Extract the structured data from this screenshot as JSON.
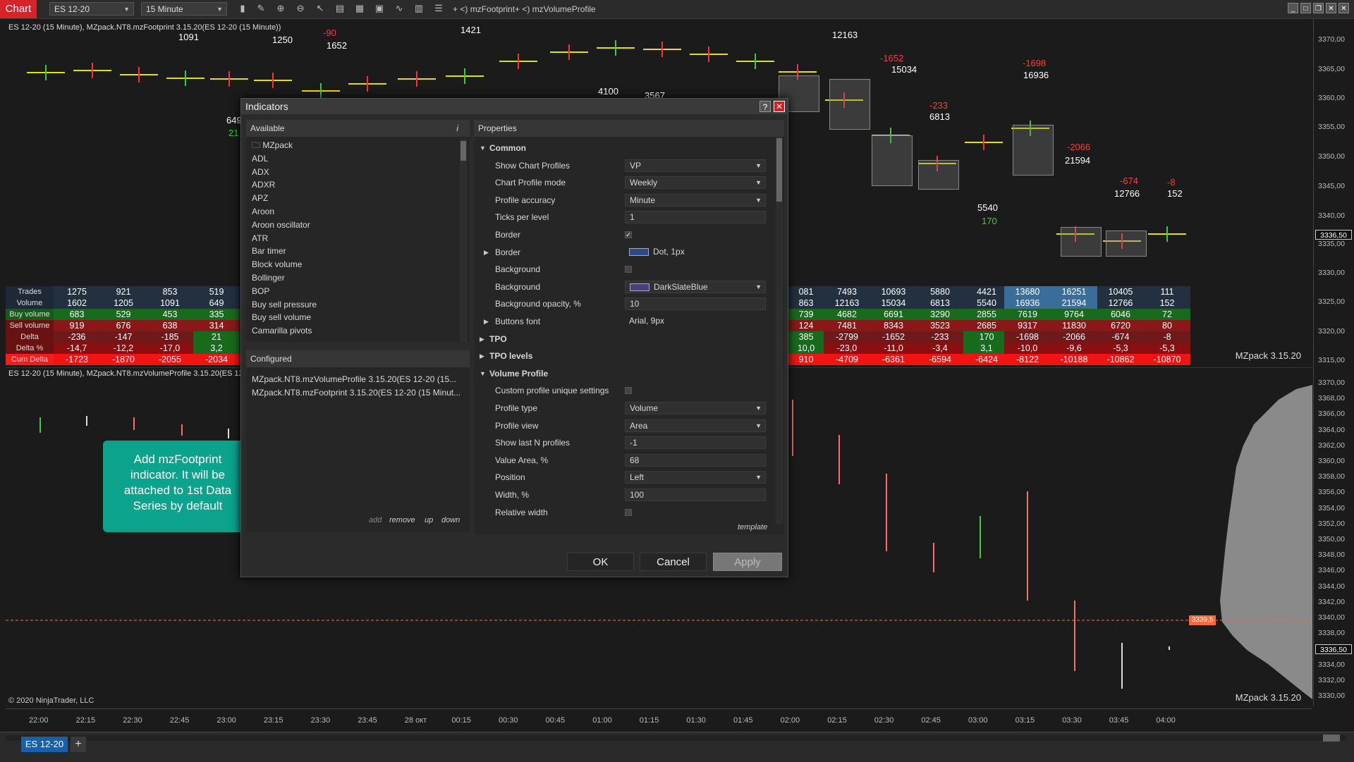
{
  "toolbar": {
    "chart_tab": "Chart",
    "instrument": "ES 12-20",
    "interval": "15 Minute",
    "indicator1": "mzFootprint",
    "indicator2": "mzVolumeProfile",
    "icons": [
      "bar-style-icon",
      "draw-icon",
      "zoom-in-icon",
      "zoom-out-icon",
      "pointer-icon",
      "data-box-icon",
      "properties-icon",
      "strategies-icon",
      "indicators-icon",
      "chart-trader-icon",
      "list-icon"
    ]
  },
  "panel_top": {
    "label": "ES 12-20 (15 Minute), MZpack.NT8.mzFootprint 3.15.20(ES 12-20 (15 Minute))",
    "watermark": "MZpack 3.15.20"
  },
  "panel_bottom": {
    "label": "ES 12-20 (15 Minute), MZpack.NT8.mzVolumeProfile 3.15.20(ES 12-20 (15 Minute))",
    "watermark": "MZpack 3.15.20",
    "copyright": "© 2020 NinjaTrader, LLC"
  },
  "prices_top": [
    "3370,00",
    "3365,00",
    "3360,00",
    "3355,00",
    "3350,00",
    "3345,00",
    "3340,00",
    "3336,50",
    "3335,00",
    "3330,00",
    "3325,00",
    "3320,00",
    "3315,00"
  ],
  "prices_bottom": [
    "3370,00",
    "3368,00",
    "3366,00",
    "3364,00",
    "3362,00",
    "3360,00",
    "3358,00",
    "3356,00",
    "3354,00",
    "3352,00",
    "3350,00",
    "3348,00",
    "3346,00",
    "3344,00",
    "3342,00",
    "3340,00",
    "3338,00",
    "3336,50",
    "3334,00",
    "3332,00",
    "3330,00"
  ],
  "price_marker_top": "3336,50",
  "price_marker_bottom": "3336,50",
  "hline_label": "3339,5",
  "times": [
    "22:00",
    "22:15",
    "22:30",
    "22:45",
    "23:00",
    "23:15",
    "23:30",
    "23:45",
    "28 окт",
    "00:15",
    "00:30",
    "00:45",
    "01:00",
    "01:15",
    "01:30",
    "01:45",
    "02:00",
    "02:15",
    "02:30",
    "02:45",
    "03:00",
    "03:15",
    "03:30",
    "03:45",
    "04:00"
  ],
  "stats": {
    "labels": [
      "Trades",
      "Volume",
      "Buy volume",
      "Sell volume",
      "Delta",
      "Delta %",
      "Cum Delta"
    ],
    "left_cols": [
      [
        "1275",
        "1602",
        "683",
        "919",
        "-236",
        "-14,7",
        "-1723"
      ],
      [
        "921",
        "1205",
        "529",
        "676",
        "-147",
        "-12,2",
        "-1870"
      ],
      [
        "853",
        "1091",
        "453",
        "638",
        "-185",
        "-17,0",
        "-2055"
      ],
      [
        "519",
        "649",
        "335",
        "314",
        "21",
        "3,2",
        "-2034"
      ]
    ],
    "right_cols": [
      [
        "081",
        "863",
        "739",
        "124",
        "385",
        "10,0",
        "910"
      ],
      [
        "7493",
        "12163",
        "4682",
        "7481",
        "-2799",
        "-23,0",
        "-4709"
      ],
      [
        "10693",
        "15034",
        "6691",
        "8343",
        "-1652",
        "-11,0",
        "-6361"
      ],
      [
        "5880",
        "6813",
        "3290",
        "3523",
        "-233",
        "-3,4",
        "-6594"
      ],
      [
        "4421",
        "5540",
        "2855",
        "2685",
        "170",
        "3,1",
        "-6424"
      ],
      [
        "13680",
        "16936",
        "7619",
        "9317",
        "-1698",
        "-10,0",
        "-8122"
      ],
      [
        "16251",
        "21594",
        "9764",
        "11830",
        "-2066",
        "-9,6",
        "-10188"
      ],
      [
        "10405",
        "12766",
        "6046",
        "6720",
        "-674",
        "-5,3",
        "-10862"
      ],
      [
        "111",
        "152",
        "72",
        "80",
        "-8",
        "-5,3",
        "-10870"
      ]
    ]
  },
  "footprint_labels": [
    {
      "t": "1091",
      "c": "#fff"
    },
    {
      "t": "1250",
      "c": "#fff"
    },
    {
      "t": "-90",
      "c": "#ff3b3b"
    },
    {
      "t": "1652",
      "c": "#fff"
    },
    {
      "t": "1421",
      "c": "#fff"
    },
    {
      "t": "4100",
      "c": "#fff"
    },
    {
      "t": "3567",
      "c": "#fff"
    },
    {
      "t": "12163",
      "c": "#fff"
    },
    {
      "t": "-1652",
      "c": "#ff3b3b"
    },
    {
      "t": "15034",
      "c": "#fff"
    },
    {
      "t": "-233",
      "c": "#ff3b3b"
    },
    {
      "t": "6813",
      "c": "#fff"
    },
    {
      "t": "-1698",
      "c": "#ff3b3b"
    },
    {
      "t": "16936",
      "c": "#fff"
    },
    {
      "t": "-2066",
      "c": "#ff3b3b"
    },
    {
      "t": "21594",
      "c": "#fff"
    },
    {
      "t": "-674",
      "c": "#ff3b3b"
    },
    {
      "t": "12766",
      "c": "#fff"
    },
    {
      "t": "-8",
      "c": "#ff3b3b"
    },
    {
      "t": "152",
      "c": "#fff"
    },
    {
      "t": "5540",
      "c": "#fff"
    },
    {
      "t": "170",
      "c": "#36d136"
    },
    {
      "t": "649",
      "c": "#fff"
    },
    {
      "t": "21",
      "c": "#36d136"
    }
  ],
  "dialog": {
    "title": "Indicators",
    "available_header": "Available",
    "available": [
      "MZpack",
      "ADL",
      "ADX",
      "ADXR",
      "APZ",
      "Aroon",
      "Aroon oscillator",
      "ATR",
      "Bar timer",
      "Block volume",
      "Bollinger",
      "BOP",
      "Buy sell pressure",
      "Buy sell volume",
      "Camarilla pivots"
    ],
    "configured_header": "Configured",
    "configured": [
      "MZpack.NT8.mzVolumeProfile 3.15.20(ES 12-20 (15...",
      "MZpack.NT8.mzFootprint 3.15.20(ES 12-20 (15 Minut..."
    ],
    "links": {
      "add": "add",
      "remove": "remove",
      "up": "up",
      "down": "down",
      "template": "template"
    },
    "properties_header": "Properties",
    "properties": [
      {
        "kind": "section",
        "label": "Common",
        "open": true
      },
      {
        "kind": "select",
        "label": "Show Chart Profiles",
        "value": "VP"
      },
      {
        "kind": "select",
        "label": "Chart Profile mode",
        "value": "Weekly"
      },
      {
        "kind": "select",
        "label": "Profile accuracy",
        "value": "Minute"
      },
      {
        "kind": "text",
        "label": "Ticks per level",
        "value": "1"
      },
      {
        "kind": "check",
        "label": "Border",
        "value": "✓"
      },
      {
        "kind": "expand",
        "label": "Border",
        "value": "Dot, 1px",
        "swatch": "#2b4a8a"
      },
      {
        "kind": "check",
        "label": "Background",
        "value": ""
      },
      {
        "kind": "select",
        "label": "Background",
        "value": "DarkSlateBlue",
        "swatch": "#483d8b"
      },
      {
        "kind": "text",
        "label": "Background opacity, %",
        "value": "10"
      },
      {
        "kind": "expand",
        "label": "Buttons font",
        "value": "Arial, 9px"
      },
      {
        "kind": "section",
        "label": "TPO",
        "open": false
      },
      {
        "kind": "section",
        "label": "TPO levels",
        "open": false
      },
      {
        "kind": "section",
        "label": "Volume Profile",
        "open": true
      },
      {
        "kind": "check",
        "label": "Custom profile unique settings",
        "value": ""
      },
      {
        "kind": "select",
        "label": "Profile type",
        "value": "Volume"
      },
      {
        "kind": "select",
        "label": "Profile view",
        "value": "Area"
      },
      {
        "kind": "text",
        "label": "Show last N profiles",
        "value": "-1"
      },
      {
        "kind": "text",
        "label": "Value Area, %",
        "value": "68"
      },
      {
        "kind": "select",
        "label": "Position",
        "value": "Left"
      },
      {
        "kind": "text",
        "label": "Width, %",
        "value": "100"
      },
      {
        "kind": "check",
        "label": "Relative width",
        "value": ""
      }
    ],
    "buttons": {
      "ok": "OK",
      "cancel": "Cancel",
      "apply": "Apply"
    }
  },
  "callout": "Add mzFootprint indicator. It will be attached to 1st Data Series by default",
  "bottom_tab": "ES 12-20",
  "add_tab": "+",
  "colors": {
    "accent_red": "#d8232a",
    "tab_blue": "#1a5fa8",
    "callout_teal": "#0ca38d"
  }
}
